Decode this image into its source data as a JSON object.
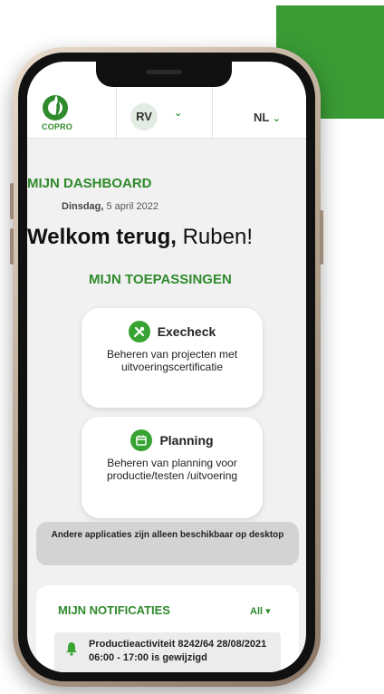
{
  "app": {
    "logo_text": "COPRO"
  },
  "header": {
    "user_initials": "RV",
    "user_chevron": "⌄",
    "language": "NL",
    "language_chevron": "⌄"
  },
  "dashboard": {
    "title": "MIJN DASHBOARD",
    "date_day": "Dinsdag,",
    "date_rest": " 5 april 2022",
    "welcome_bold": "Welkom terug,",
    "welcome_name": " Ruben!",
    "apps_title": "MIJN TOEPASSINGEN"
  },
  "apps": [
    {
      "title": "Execheck",
      "description": "Beheren van projecten met uitvoeringscertificatie",
      "icon": "tools-icon"
    },
    {
      "title": "Planning",
      "description": "Beheren van planning voor productie/testen /uitvoering",
      "icon": "calendar-icon"
    }
  ],
  "notice": {
    "text": "Andere applicaties zijn alleen beschikbaar op desktop"
  },
  "notifications": {
    "title": "MIJN NOTIFICATIES",
    "filter_label": "All ▾",
    "items": [
      {
        "icon": "bell-icon",
        "text": "Productieactiviteit 8242/64 28/08/2021 06:00 - 17:00 is gewijzigd"
      }
    ]
  },
  "colors": {
    "brand_green": "#2f8a2c",
    "accent_square": "#3a9b35"
  }
}
